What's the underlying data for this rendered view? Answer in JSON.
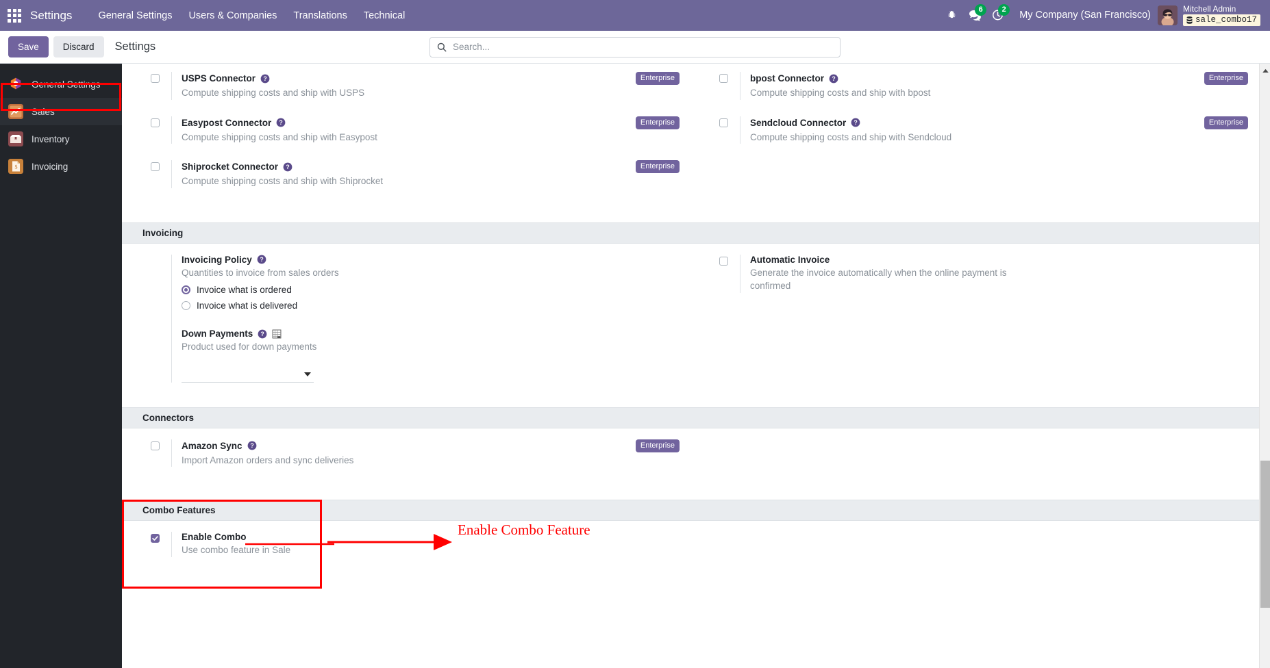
{
  "navbar": {
    "apps_icon": "apps-grid-icon",
    "brand": "Settings",
    "menus": [
      "General Settings",
      "Users & Companies",
      "Translations",
      "Technical"
    ],
    "debug_icon": "bug-icon",
    "messages_icon": "chat-icon",
    "messages_count": "6",
    "activities_icon": "clock-icon",
    "activities_count": "2",
    "company": "My Company (San Francisco)",
    "user_name": "Mitchell Admin",
    "database_icon": "database-icon",
    "database": "sale_combo17",
    "accent": "#6d6799",
    "badge_color": "#00a34f"
  },
  "control_panel": {
    "save_label": "Save",
    "discard_label": "Discard",
    "breadcrumb": "Settings",
    "search_icon": "search-icon",
    "search_value": "",
    "search_placeholder": "Search..."
  },
  "sidebar": {
    "items": [
      {
        "label": "General Settings",
        "icon": "settings-app-icon",
        "active": false
      },
      {
        "label": "Sales",
        "icon": "sales-chart-icon",
        "active": true
      },
      {
        "label": "Inventory",
        "icon": "inventory-box-icon",
        "active": false
      },
      {
        "label": "Invoicing",
        "icon": "invoicing-document-icon",
        "active": false
      }
    ],
    "highlight_color": "#ff0000"
  },
  "settings": {
    "enterprise_badge": "Enterprise",
    "help_icon": "question-circle-icon",
    "shipping_connectors": [
      {
        "title": "USPS Connector",
        "description": "Compute shipping costs and ship with USPS",
        "checked": false,
        "badge": "Enterprise"
      },
      {
        "title": "bpost Connector",
        "description": "Compute shipping costs and ship with bpost",
        "checked": false,
        "badge": "Enterprise"
      },
      {
        "title": "Easypost Connector",
        "description": "Compute shipping costs and ship with Easypost",
        "checked": false,
        "badge": "Enterprise"
      },
      {
        "title": "Sendcloud Connector",
        "description": "Compute shipping costs and ship with Sendcloud",
        "checked": false,
        "badge": "Enterprise"
      },
      {
        "title": "Shiprocket Connector",
        "description": "Compute shipping costs and ship with Shiprocket",
        "checked": false,
        "badge": "Enterprise"
      }
    ],
    "invoicing": {
      "section_title": "Invoicing",
      "policy": {
        "title": "Invoicing Policy",
        "description": "Quantities to invoice from sales orders",
        "options": [
          {
            "label": "Invoice what is ordered",
            "selected": true
          },
          {
            "label": "Invoice what is delivered",
            "selected": false
          }
        ]
      },
      "down_payments": {
        "title": "Down Payments",
        "description": "Product used for down payments",
        "internal_link_icon": "spreadsheet-icon",
        "value": "",
        "dropdown_icon": "caret-down-icon"
      },
      "automatic_invoice": {
        "title": "Automatic Invoice",
        "description": "Generate the invoice automatically when the online payment is confirmed",
        "checked": false
      }
    },
    "connectors": {
      "section_title": "Connectors",
      "amazon": {
        "title": "Amazon Sync",
        "description": "Import Amazon orders and sync deliveries",
        "checked": false,
        "badge": "Enterprise"
      }
    },
    "combo": {
      "section_title": "Combo Features",
      "enable": {
        "title": "Enable Combo",
        "description": "Use combo feature in Sale",
        "checked": true
      }
    }
  },
  "annotation": {
    "text": "Enable Combo Feature",
    "color": "#ff0000"
  }
}
